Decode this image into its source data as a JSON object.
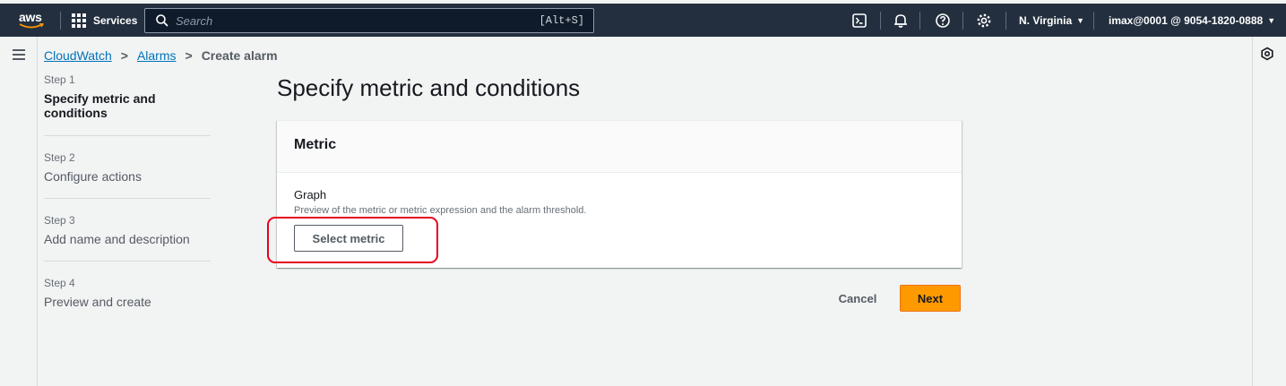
{
  "topbar": {
    "logo_text": "aws",
    "services_label": "Services",
    "search_placeholder": "Search",
    "search_shortcut": "[Alt+S]",
    "region": "N. Virginia",
    "account": "imax@0001 @ 9054-1820-0888",
    "icons": [
      "cloudshell-icon",
      "bell-icon",
      "help-icon",
      "gear-icon"
    ]
  },
  "breadcrumb": {
    "items": [
      "CloudWatch",
      "Alarms"
    ],
    "current": "Create alarm"
  },
  "steps": [
    {
      "num": "Step 1",
      "label": "Specify metric and conditions"
    },
    {
      "num": "Step 2",
      "label": "Configure actions"
    },
    {
      "num": "Step 3",
      "label": "Add name and description"
    },
    {
      "num": "Step 4",
      "label": "Preview and create"
    }
  ],
  "main": {
    "title": "Specify metric and conditions",
    "card": {
      "header": "Metric",
      "field_label": "Graph",
      "field_desc": "Preview of the metric or metric expression and the alarm threshold.",
      "select_button": "Select metric"
    },
    "cancel_label": "Cancel",
    "next_label": "Next"
  },
  "colors": {
    "topbar_bg": "#232f3e",
    "link": "#0073bb",
    "primary_button": "#ff9900",
    "highlight": "#e8001c"
  }
}
